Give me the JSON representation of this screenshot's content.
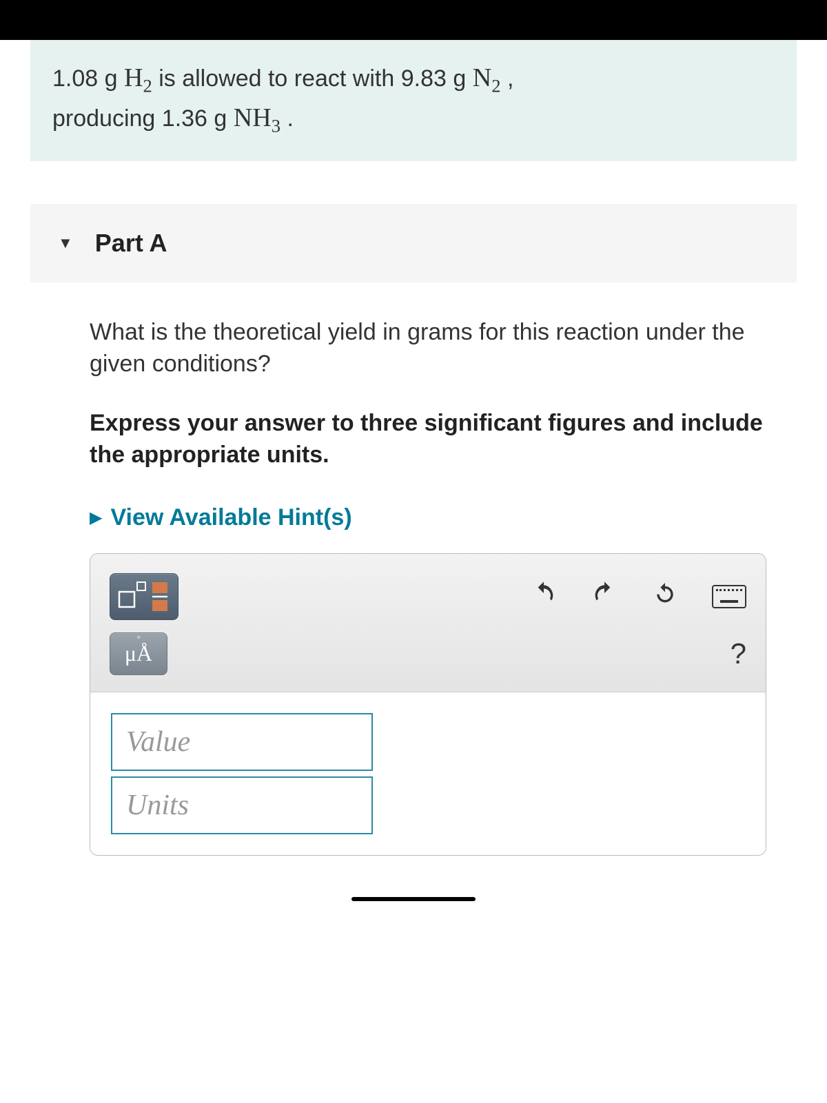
{
  "problem": {
    "mass_h2": "1.08",
    "unit_h2": "g",
    "formula_h2": "H",
    "sub_h2": "2",
    "verb1": " is allowed to react with ",
    "mass_n2": "9.83",
    "unit_n2": "g",
    "formula_n2": "N",
    "sub_n2": "2",
    "comma": " ,",
    "line2a": "producing ",
    "mass_nh3": "1.36",
    "unit_nh3": "g",
    "formula_nh3": "NH",
    "sub_nh3": "3",
    "period": " ."
  },
  "part": {
    "label": "Part A"
  },
  "question": {
    "text": "What is the theoretical yield in grams for this reaction under the given conditions?",
    "instruction": "Express your answer to three significant figures and include the appropriate units."
  },
  "hints": {
    "label": "View Available Hint(s)"
  },
  "toolbar": {
    "units_button": "μÅ",
    "help": "?"
  },
  "inputs": {
    "value_placeholder": "Value",
    "units_placeholder": "Units"
  }
}
